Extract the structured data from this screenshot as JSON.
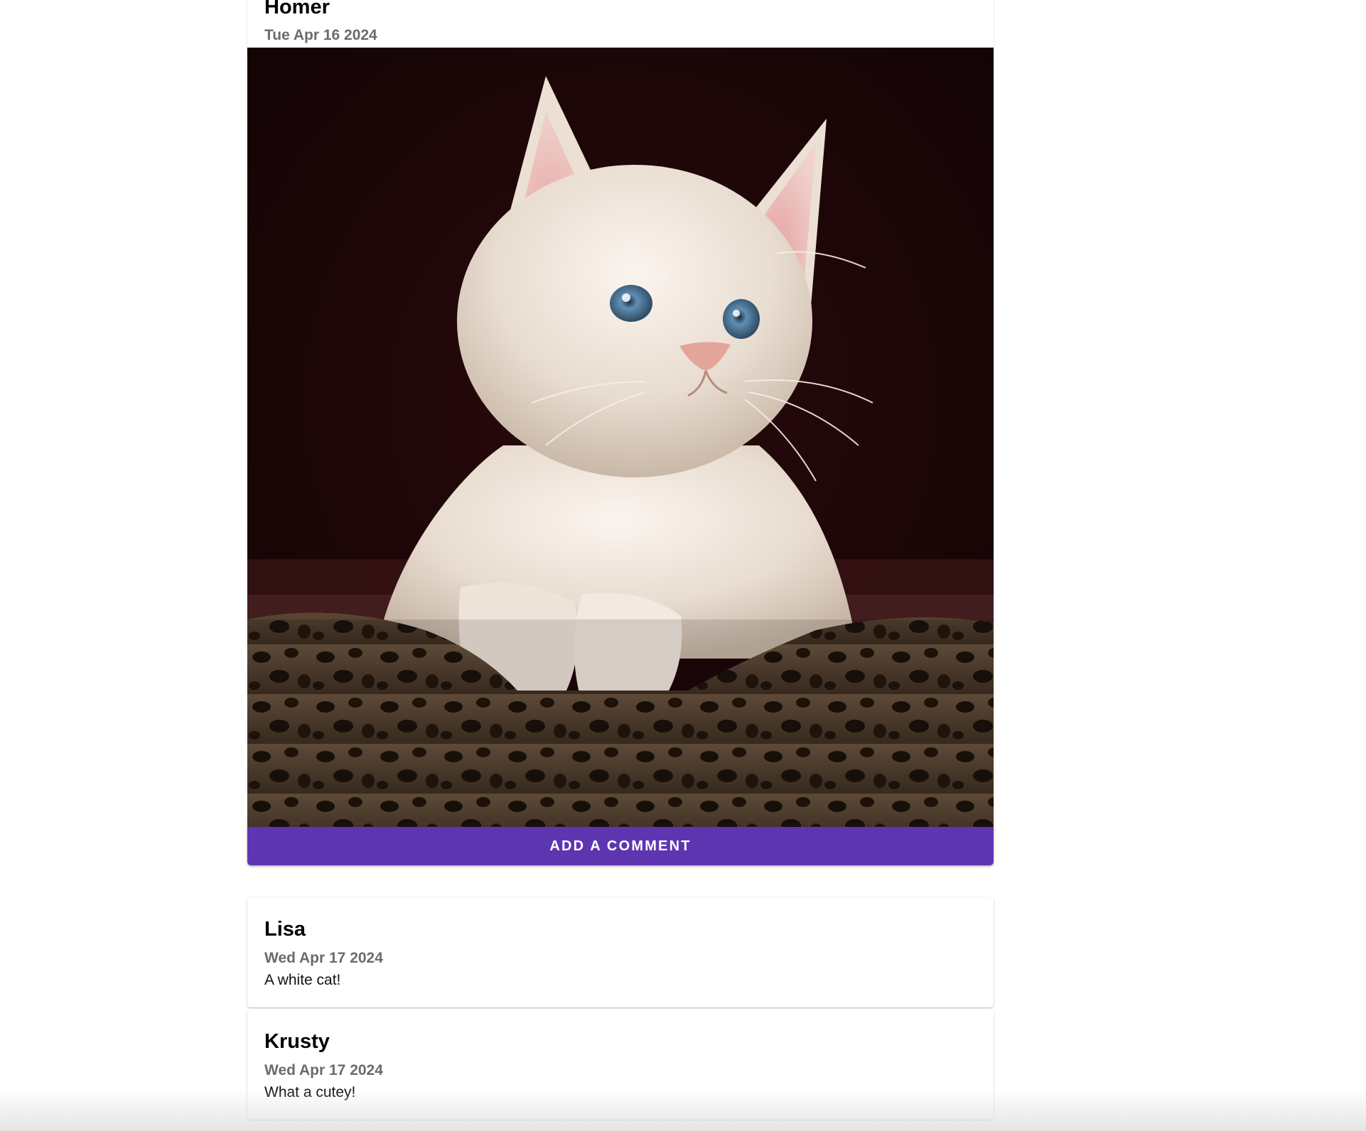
{
  "post": {
    "author": "Homer",
    "date": "Tue Apr 16 2024",
    "photo_icon": "kitten-photo",
    "add_comment_label": "ADD A COMMENT"
  },
  "comments": [
    {
      "author": "Lisa",
      "date": "Wed Apr 17 2024",
      "text": "A white cat!"
    },
    {
      "author": "Krusty",
      "date": "Wed Apr 17 2024",
      "text": "What a cutey!"
    }
  ],
  "colors": {
    "accent": "#5e35b1",
    "date_text": "#6b6b6b",
    "photo_background": "#1a0506"
  }
}
